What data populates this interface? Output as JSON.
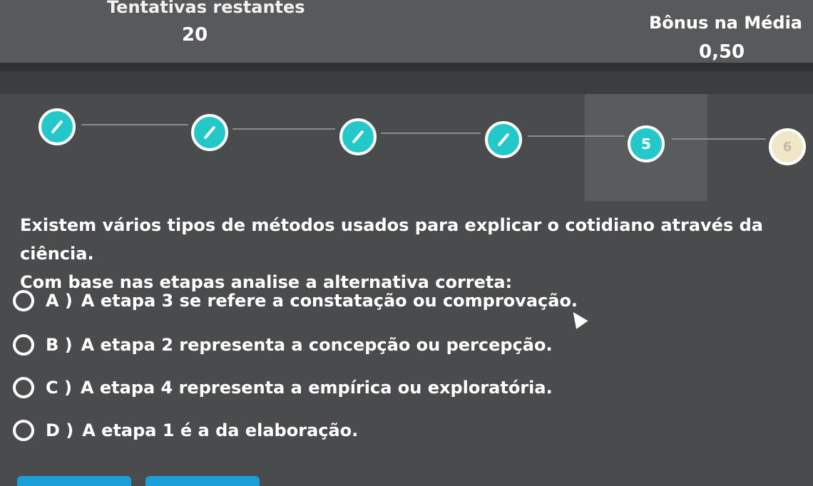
{
  "header": {
    "attempts_label": "Tentativas restantes",
    "attempts_value": "20",
    "bonus_label": "Bônus na Média",
    "bonus_value": "0,50"
  },
  "steps": [
    {
      "status": "done",
      "icon": "pencil-icon"
    },
    {
      "status": "done",
      "icon": "pencil-icon"
    },
    {
      "status": "done",
      "icon": "pencil-icon"
    },
    {
      "status": "done",
      "icon": "pencil-icon"
    },
    {
      "status": "current",
      "label": "5"
    },
    {
      "status": "upcoming",
      "label": "6"
    }
  ],
  "question": {
    "line1": "Existem vários tipos de métodos usados para  explicar o cotidiano através da ciência.",
    "line2": "Com base nas etapas analise a alternativa correta:"
  },
  "options": [
    {
      "letter": "A )",
      "text": "A etapa 3 se refere a constatação ou comprovação."
    },
    {
      "letter": "B )",
      "text": "A etapa 2 representa a concepção ou percepção."
    },
    {
      "letter": "C )",
      "text": "A etapa 4 representa a empírica ou exploratória."
    },
    {
      "letter": "D )",
      "text": "A etapa 1 é a da elaboração."
    }
  ],
  "colors": {
    "accent": "#24c8c8",
    "background": "#4a4b4c",
    "button": "#1a9fd8"
  }
}
